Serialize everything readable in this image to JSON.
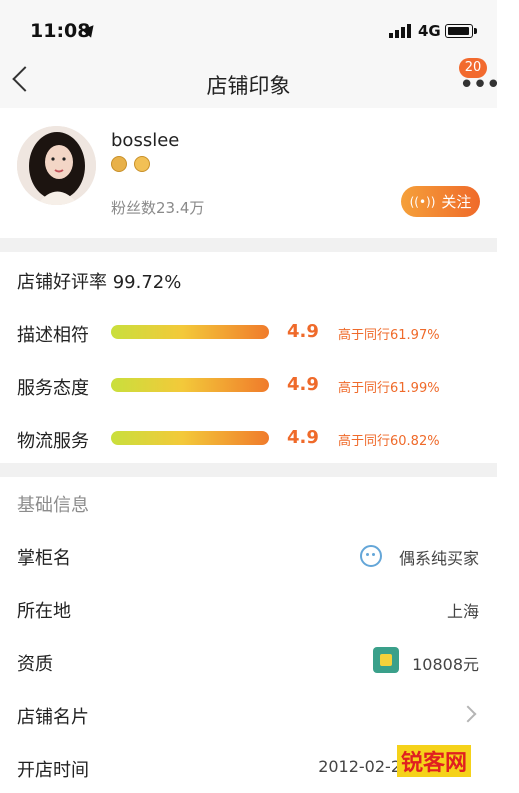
{
  "status_bar": {
    "time": "11:08",
    "network": "4G"
  },
  "nav": {
    "title": "店铺印象",
    "badge_count": "20",
    "back_icon": "chevron-left-icon",
    "more_icon": "more-dots-icon"
  },
  "profile": {
    "username": "bosslee",
    "fans": "粉丝数23.4万",
    "follow_label": "关注",
    "medals": [
      "award-medal-icon",
      "crown-icon"
    ]
  },
  "ratings": {
    "good_rate": "店铺好评率 99.72%",
    "rows": [
      {
        "label": "描述相符",
        "score": "4.9",
        "compare": "高于同行61.97%"
      },
      {
        "label": "服务态度",
        "score": "4.9",
        "compare": "高于同行61.99%"
      },
      {
        "label": "物流服务",
        "score": "4.9",
        "compare": "高于同行60.82%"
      }
    ]
  },
  "basic_info": {
    "title": "基础信息",
    "rows": [
      {
        "label": "掌柜名",
        "value": "偶系纯买家"
      },
      {
        "label": "所在地",
        "value": "上海"
      },
      {
        "label": "资质",
        "value": "10808元"
      },
      {
        "label": "店铺名片",
        "value": ""
      },
      {
        "label": "开店时间",
        "value": "2012-02-2"
      }
    ]
  },
  "watermark": "锐客网",
  "colors": {
    "accent": "#ef6a2a",
    "bar_start": "#c9df3c",
    "bar_end": "#f07b2b"
  }
}
